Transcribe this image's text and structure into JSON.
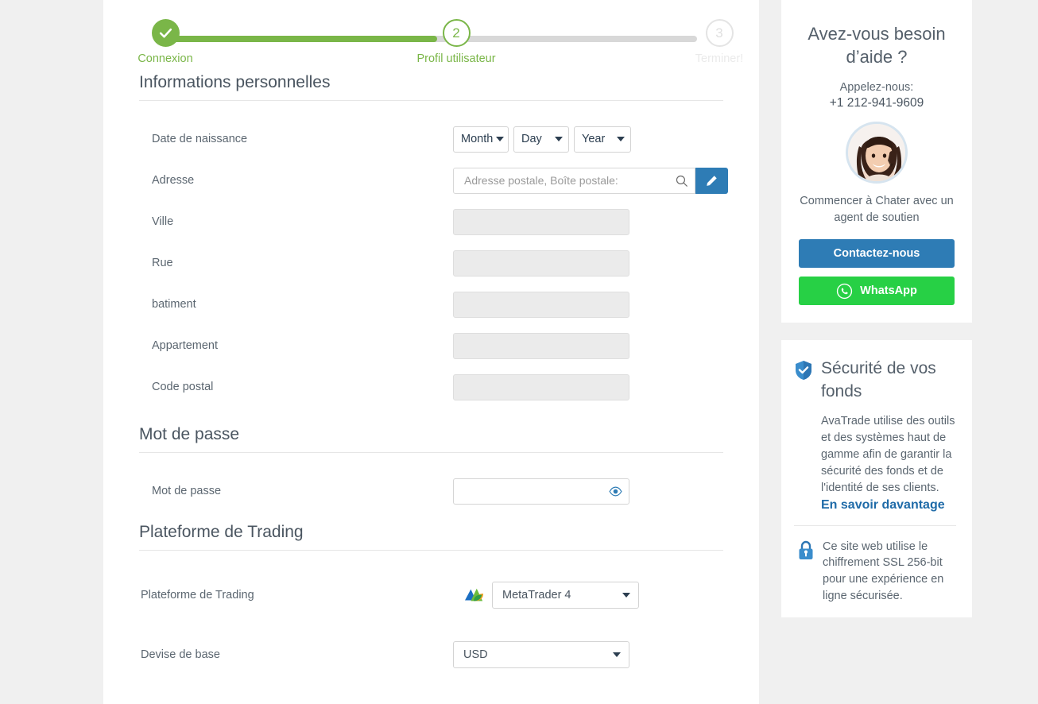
{
  "stepper": {
    "steps": [
      {
        "num": "1",
        "label": "Connexion",
        "state": "done",
        "icon": "check-icon"
      },
      {
        "num": "2",
        "label": "Profil utilisateur",
        "state": "current"
      },
      {
        "num": "3",
        "label": "Terminer!",
        "state": "todo"
      }
    ]
  },
  "sections": {
    "personal": {
      "title": "Informations personnelles"
    },
    "password": {
      "title": "Mot de passe"
    },
    "platform": {
      "title": "Plateforme de Trading"
    }
  },
  "fields": {
    "dob": {
      "label": "Date de naissance",
      "month": "Month",
      "day": "Day",
      "year": "Year"
    },
    "address": {
      "label": "Adresse",
      "placeholder": "Adresse postale, Boîte postale:",
      "value": ""
    },
    "city": {
      "label": "Ville",
      "value": ""
    },
    "street": {
      "label": "Rue",
      "value": ""
    },
    "building": {
      "label": "batiment",
      "value": ""
    },
    "apartment": {
      "label": "Appartement",
      "value": ""
    },
    "zip": {
      "label": "Code postal",
      "value": ""
    },
    "password": {
      "label": "Mot de passe",
      "value": ""
    },
    "trading_platform": {
      "label": "Plateforme de Trading",
      "value": "MetaTrader 4"
    },
    "base_currency": {
      "label": "Devise de base",
      "value": "USD"
    }
  },
  "help": {
    "title": "Avez-vous besoin d’aide ?",
    "call_label": "Appelez-nous:",
    "phone": "+1 212-941-9609",
    "chat_text": "Commencer à Chater avec un agent de soutien",
    "contact_button": "Contactez-nous",
    "whatsapp_button": "WhatsApp"
  },
  "security": {
    "title": "Sécurité de vos fonds",
    "body": "AvaTrade utilise des outils et des systèmes haut de gamme afin de garantir la sécurité des fonds et de l'identité de ses clients.",
    "link": "En savoir davantage",
    "ssl_text": "Ce site web utilise le chiffrement SSL 256-bit pour une expérience en ligne sécurisée."
  },
  "colors": {
    "green": "#7ab648",
    "blue": "#2e7cb5",
    "whatsapp_green": "#27d045",
    "link_blue": "#1f6ba8",
    "page_bg": "#f0f0f0"
  }
}
